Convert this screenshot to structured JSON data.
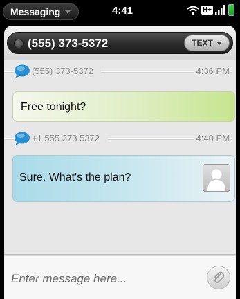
{
  "status_bar": {
    "app_menu_label": "Messaging",
    "time": "4:41",
    "network_label": "H+"
  },
  "header": {
    "contact_number": "(555) 373-5372",
    "transport_label": "TEXT"
  },
  "messages": [
    {
      "sender": "(555) 373-5372",
      "time": "4:36 PM",
      "text": "Free tonight?",
      "direction": "incoming"
    },
    {
      "sender": "+1 555 373 5372",
      "time": "4:40 PM",
      "text": "Sure. What's the plan?",
      "direction": "outgoing"
    }
  ],
  "compose": {
    "placeholder": "Enter message here...",
    "value": ""
  },
  "colors": {
    "incoming_bubble": "#c6e58f",
    "outgoing_bubble": "#a9dbe9",
    "chat_icon": "#2a8fd0",
    "battery": "#2cc12c"
  }
}
